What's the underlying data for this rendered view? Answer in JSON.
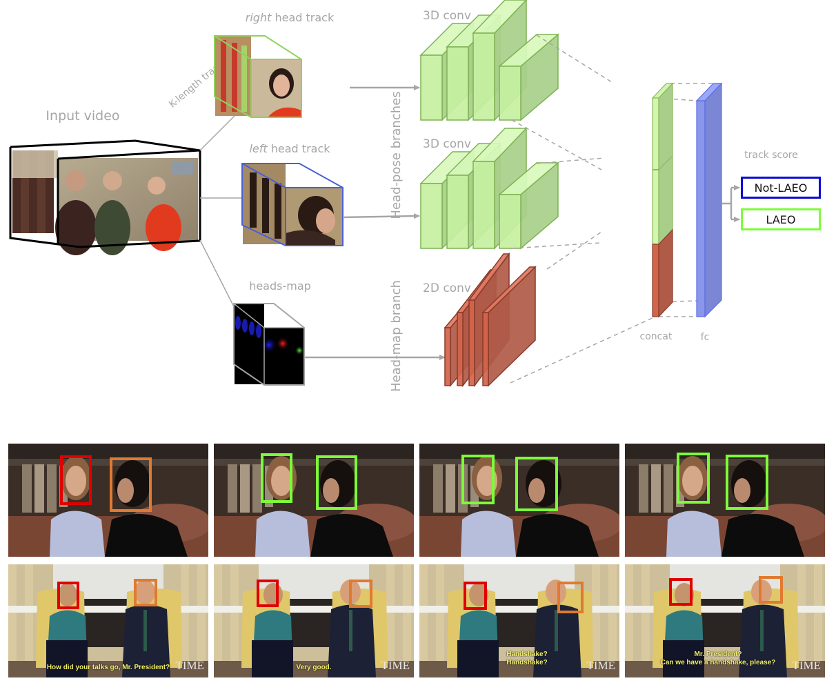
{
  "diagram": {
    "input_video_label": "Input video",
    "k_length_tracks_label": "K-length tracks",
    "right_track_label_em": "right",
    "right_track_label_rest": " head track",
    "left_track_label_em": "left",
    "left_track_label_rest": " head track",
    "heads_map_label": "heads-map",
    "head_pose_branches_label": "Head-pose branches",
    "head_map_branch_label": "Head-map branch",
    "conv3d_top_label": "3D conv",
    "conv3d_bottom_label": "3D conv",
    "conv2d_label": "2D conv",
    "concat_label": "concat",
    "fc_label": "fc",
    "track_score_label": "track score",
    "outputs": [
      {
        "label": "Not-LAEO",
        "color": "#0a0ad6"
      },
      {
        "label": "LAEO",
        "color": "#7dfc3a"
      }
    ],
    "colors": {
      "right_track": "#8ed35a",
      "left_track": "#4b5fd6",
      "head_pose_conv": "#c6f0a0",
      "head_map_conv": "#c9563f",
      "fc": "#7f8fe6",
      "label_gray": "#a6a6a6"
    }
  },
  "examples": {
    "box_colors": {
      "red": "#e00000",
      "orange": "#e07a30",
      "green": "#7dfc3a"
    },
    "row1": [
      {
        "left_box": "red",
        "right_box": "orange"
      },
      {
        "left_box": "green",
        "right_box": "green"
      },
      {
        "left_box": "green",
        "right_box": "green"
      },
      {
        "left_box": "green",
        "right_box": "green"
      }
    ],
    "row2": [
      {
        "left_box": "red",
        "right_box": "orange",
        "caption": [
          "How did your talks go, Mr. President?"
        ],
        "watermark": "TIME"
      },
      {
        "left_box": "red",
        "right_box": "orange",
        "caption": [
          "Very good."
        ],
        "watermark": "TIME"
      },
      {
        "left_box": "red",
        "right_box": "orange",
        "caption": [
          "Handshake?",
          "Handshake?"
        ],
        "watermark": "TIME"
      },
      {
        "left_box": "red",
        "right_box": "orange",
        "caption": [
          "Mr. President?",
          "Can we have a handshake, please?"
        ],
        "watermark": "TIME"
      }
    ]
  }
}
